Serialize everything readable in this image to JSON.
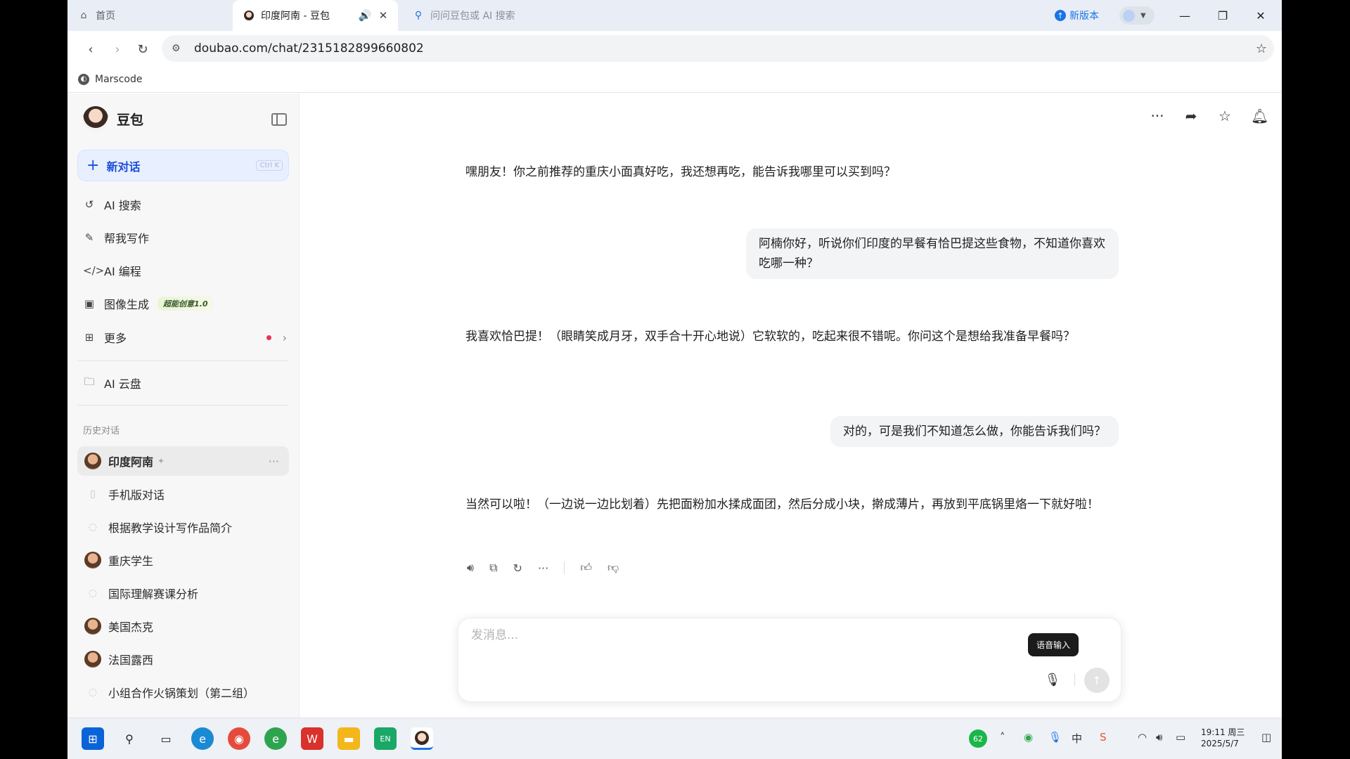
{
  "browser": {
    "tabs": [
      {
        "title": "首页"
      },
      {
        "title": "印度阿南 - 豆包"
      },
      {
        "title": "问问豆包或 AI 搜索"
      }
    ],
    "new_version": "新版本",
    "url": "doubao.com/chat/2315182899660802",
    "bookmark": "Marscode"
  },
  "sidebar": {
    "brand": "豆包",
    "new_chat": {
      "label": "新对话",
      "shortcut": "Ctrl K"
    },
    "nav": [
      {
        "label": "AI 搜索",
        "icon": "ai-search-icon"
      },
      {
        "label": "帮我写作",
        "icon": "pen-icon"
      },
      {
        "label": "AI 编程",
        "icon": "code-icon"
      },
      {
        "label": "图像生成",
        "icon": "image-icon",
        "badge": "超能创意1.0"
      },
      {
        "label": "更多",
        "icon": "grid-icon"
      },
      {
        "label": "AI 云盘",
        "icon": "cloud-drive-icon"
      }
    ],
    "history_label": "历史对话",
    "history": [
      {
        "label": "印度阿南"
      },
      {
        "label": "手机版对话"
      },
      {
        "label": "根据教学设计写作品简介"
      },
      {
        "label": "重庆学生"
      },
      {
        "label": "国际理解赛课分析"
      },
      {
        "label": "美国杰克"
      },
      {
        "label": "法国露西"
      },
      {
        "label": "小组合作火锅策划（第二组）"
      }
    ]
  },
  "chat": {
    "messages": [
      {
        "role": "ai",
        "text": "嘿朋友！你之前推荐的重庆小面真好吃，我还想再吃，能告诉我哪里可以买到吗？"
      },
      {
        "role": "user",
        "text": "阿楠你好，听说你们印度的早餐有恰巴提这些食物，不知道你喜欢吃哪一种？"
      },
      {
        "role": "ai",
        "text": "我喜欢恰巴提！（眼睛笑成月牙，双手合十开心地说）它软软的，吃起来很不错呢。你问这个是想给我准备早餐吗？"
      },
      {
        "role": "user",
        "text": "对的，可是我们不知道怎么做，你能告诉我们吗？"
      },
      {
        "role": "ai",
        "text": "当然可以啦！（一边说一边比划着）先把面粉加水揉成面团，然后分成小块，擀成薄片，再放到平底锅里烙一下就好啦！"
      }
    ],
    "composer_placeholder": "发消息...",
    "tooltip": "语音输入"
  },
  "taskbar": {
    "badge_count": "62",
    "time": "19:11 周三",
    "date": "2025/5/7",
    "lang": "EN",
    "ime": "中"
  },
  "colors": {
    "accent": "#1d4ed8",
    "sidebar_bg": "#f7f7f8",
    "user_bubble": "#f3f4f6"
  }
}
